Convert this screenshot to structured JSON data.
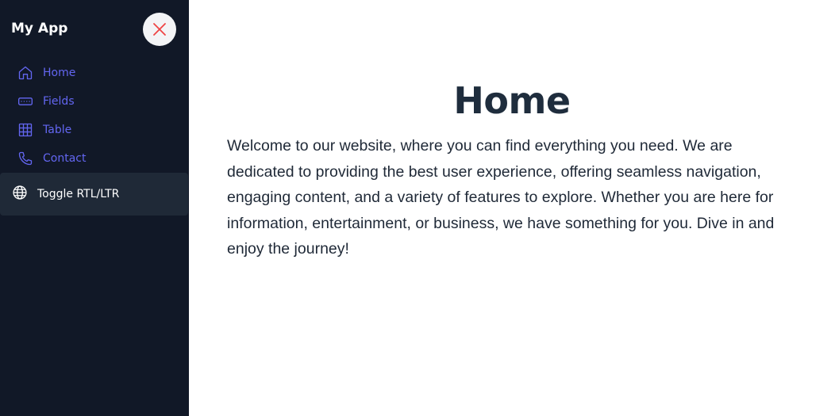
{
  "sidebar": {
    "app_title": "My App",
    "close_button_icon": "close-icon",
    "items": [
      {
        "label": "Home",
        "icon": "home-icon"
      },
      {
        "label": "Fields",
        "icon": "input-field-icon"
      },
      {
        "label": "Table",
        "icon": "grid-table-icon"
      },
      {
        "label": "Contact",
        "icon": "phone-icon"
      }
    ],
    "toggle": {
      "label": "Toggle RTL/LTR",
      "icon": "globe-icon"
    }
  },
  "main": {
    "title": "Home",
    "body": "Welcome to our website, where you can find everything you need. We are dedicated to providing the best user experience, offering seamless navigation, engaging content, and a variety of features to explore. Whether you are here for information, entertainment, or business, we have something for you. Dive in and enjoy the journey!"
  },
  "colors": {
    "sidebar_bg": "#111827",
    "nav_accent": "#6366f1",
    "close_icon": "#ef4444",
    "toggle_bg": "#1f2937",
    "title_text": "#1f2d3d"
  }
}
